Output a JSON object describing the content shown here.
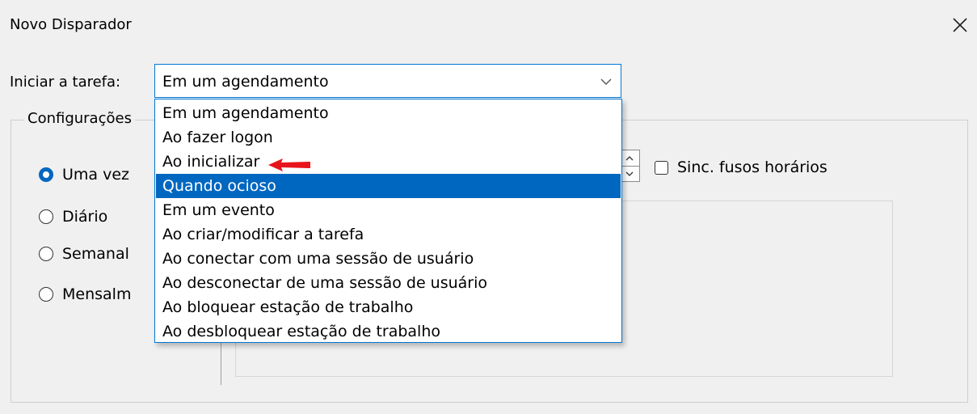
{
  "window": {
    "title": "Novo Disparador"
  },
  "start_task": {
    "label": "Iniciar a tarefa:",
    "selected": "Em um agendamento"
  },
  "settings": {
    "label": "Configurações",
    "radios": [
      {
        "label": "Uma vez",
        "checked": true
      },
      {
        "label": "Diário",
        "checked": false
      },
      {
        "label": "Semanal",
        "checked": false
      },
      {
        "label": "Mensalm",
        "checked": false
      }
    ],
    "sync_timezones_label": "Sinc. fusos horários"
  },
  "dropdown": {
    "options": [
      "Em um agendamento",
      "Ao fazer logon",
      "Ao inicializar",
      "Quando ocioso",
      "Em um evento",
      "Ao criar/modificar a tarefa",
      "Ao conectar com uma sessão de usuário",
      "Ao desconectar de uma sessão de usuário",
      "Ao bloquear estação de trabalho",
      "Ao desbloquear estação de trabalho"
    ],
    "highlighted": "Quando ocioso"
  },
  "colors": {
    "accent": "#0067c0",
    "focus_border": "#0078d7",
    "annotation_arrow": "#e8141b"
  }
}
